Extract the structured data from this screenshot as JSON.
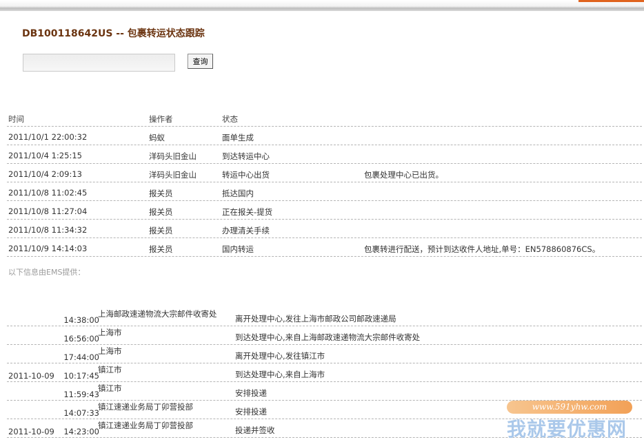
{
  "title": "DB100118642US -- 包裹转运状态跟踪",
  "search": {
    "value": "",
    "button": "查询"
  },
  "tracking": {
    "headers": [
      "时间",
      "操作者",
      "状态",
      ""
    ],
    "rows": [
      [
        "2011/10/1 22:00:32",
        "蚂蚁",
        "面单生成",
        ""
      ],
      [
        "2011/10/4 1:25:15",
        "洋码头旧金山",
        "到达转运中心",
        ""
      ],
      [
        "2011/10/4 2:09:13",
        "洋码头旧金山",
        "转运中心出货",
        "包裹处理中心已出货。"
      ],
      [
        "2011/10/8 11:02:45",
        "报关员",
        "抵达国内",
        ""
      ],
      [
        "2011/10/8 11:27:04",
        "报关员",
        "正在报关-提货",
        ""
      ],
      [
        "2011/10/8 11:34:32",
        "报关员",
        "办理清关手续",
        ""
      ],
      [
        "2011/10/9 14:14:03",
        "报关员",
        "国内转运",
        "包裹转进行配送，预计到达收件人地址,单号：EN578860876CS。"
      ]
    ]
  },
  "ems_note": "以下信息由EMS提供：",
  "ems": {
    "rows": [
      {
        "date": "",
        "time": "14:38:00",
        "location": "上海邮政速递物流大宗邮件收寄处",
        "message": "离开处理中心,发往上海市邮政公司邮政速递局"
      },
      {
        "date": "",
        "time": "16:56:00",
        "location": "上海市",
        "message": "到达处理中心,来自上海邮政速递物流大宗邮件收寄处"
      },
      {
        "date": "",
        "time": "17:44:00",
        "location": "上海市",
        "message": "离开处理中心,发往镇江市"
      },
      {
        "date": "2011-10-09",
        "time": "10:17:45",
        "location": "镇江市",
        "message": "到达处理中心,来自上海市"
      },
      {
        "date": "",
        "time": "11:59:43",
        "location": "镇江市",
        "message": "安排投递"
      },
      {
        "date": "",
        "time": "14:07:33",
        "location": "镇江速递业务局丁卯营投部",
        "message": "安排投递"
      },
      {
        "date": "2011-10-09",
        "time": "14:23:00",
        "location": "镇江速递业务局丁卯营投部",
        "message": "投递并签收"
      }
    ]
  },
  "watermark": {
    "url": "www.591yhw.com",
    "text": "我就要优惠网"
  }
}
